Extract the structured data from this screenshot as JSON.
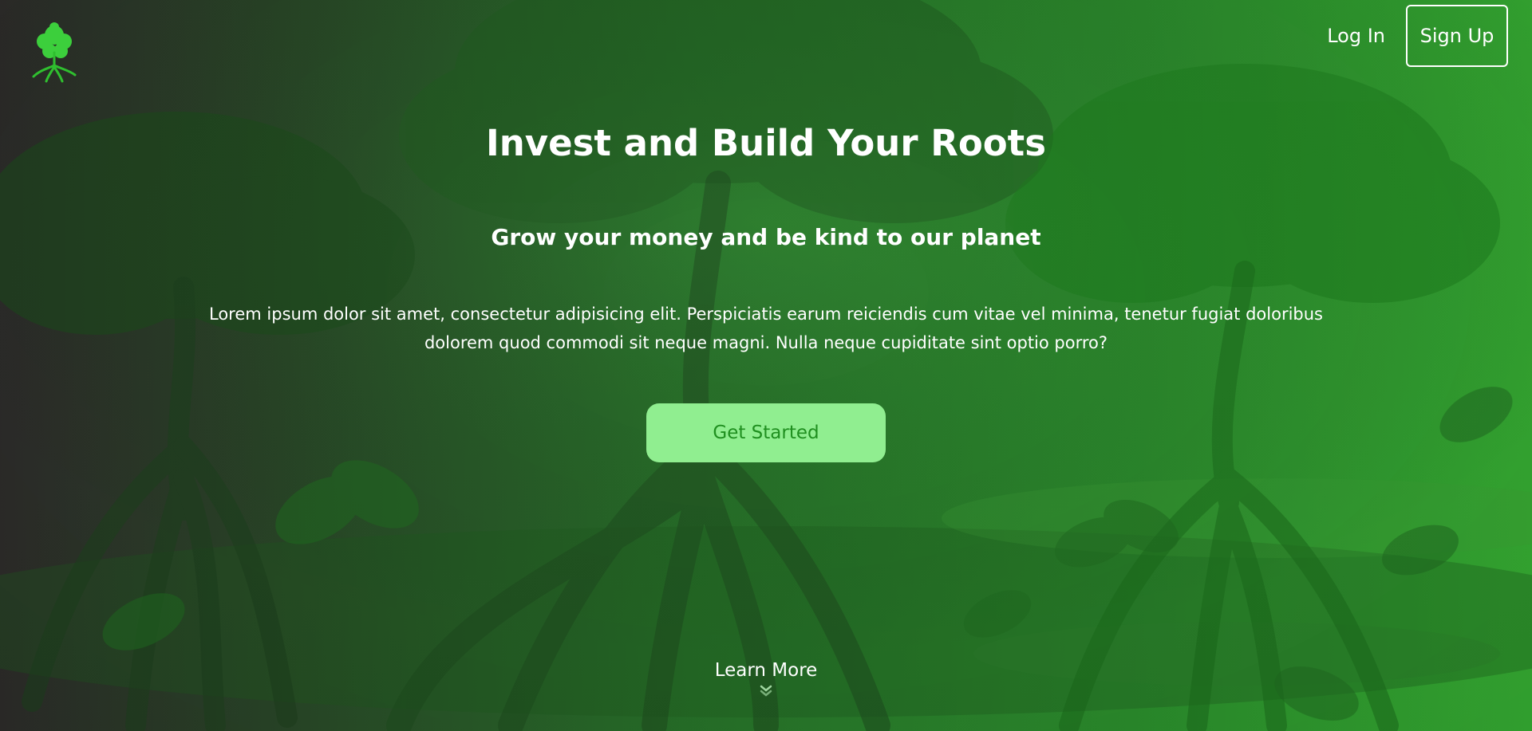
{
  "header": {
    "logo_icon": "tree-logo-icon",
    "login_label": "Log In",
    "signup_label": "Sign Up"
  },
  "hero": {
    "title": "Invest and Build Your Roots",
    "subtitle": "Grow your money and be kind to our planet",
    "description": "Lorem ipsum dolor sit amet, consectetur adipisicing elit. Perspiciatis earum reiciendis cum vitae vel minima, tenetur fugiat doloribus dolorem quod commodi sit neque magni. Nulla neque cupiditate sint optio porro?",
    "cta_label": "Get Started",
    "learn_more_label": "Learn More",
    "learn_more_icon": "chevron-down-icon"
  },
  "colors": {
    "accent": "#90ee90",
    "accent_text": "#1f8f1f",
    "text": "#ffffff",
    "bg_dark": "#2c2b29",
    "bg_green": "#34a831"
  }
}
